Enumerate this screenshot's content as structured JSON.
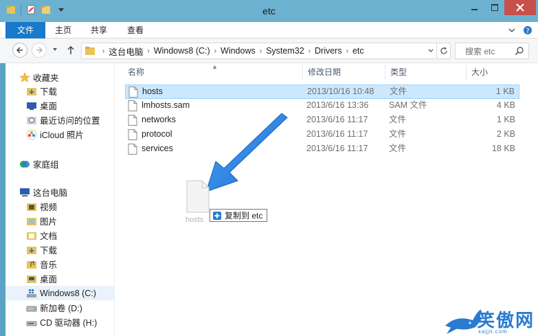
{
  "window": {
    "title": "etc"
  },
  "ribbon": {
    "tabs": [
      "文件",
      "主页",
      "共享",
      "查看"
    ]
  },
  "address": {
    "crumbs": [
      "这台电脑",
      "Windows8 (C:)",
      "Windows",
      "System32",
      "Drivers",
      "etc"
    ],
    "search_placeholder": "搜索 etc"
  },
  "sidebar": {
    "favorites_label": "收藏夹",
    "favorites": [
      "下载",
      "桌面",
      "最近访问的位置",
      "iCloud 照片"
    ],
    "homegroup_label": "家庭组",
    "pc_label": "这台电脑",
    "pc_items": [
      "视频",
      "图片",
      "文档",
      "下载",
      "音乐",
      "桌面",
      "Windows8 (C:)",
      "新加卷 (D:)",
      "CD 驱动器 (H:)"
    ],
    "selected": "Windows8 (C:)"
  },
  "columns": {
    "name": "名称",
    "date": "修改日期",
    "type": "类型",
    "size": "大小"
  },
  "files": [
    {
      "name": "hosts",
      "date": "2013/10/16 10:48",
      "type": "文件",
      "size": "1 KB",
      "selected": true
    },
    {
      "name": "lmhosts.sam",
      "date": "2013/6/16 13:36",
      "type": "SAM 文件",
      "size": "4 KB",
      "selected": false
    },
    {
      "name": "networks",
      "date": "2013/6/16 11:17",
      "type": "文件",
      "size": "1 KB",
      "selected": false
    },
    {
      "name": "protocol",
      "date": "2013/6/16 11:17",
      "type": "文件",
      "size": "2 KB",
      "selected": false
    },
    {
      "name": "services",
      "date": "2013/6/16 11:17",
      "type": "文件",
      "size": "18 KB",
      "selected": false
    }
  ],
  "drag": {
    "ghost_label": "hosts",
    "tooltip": "复制到 etc"
  },
  "watermark": {
    "text": "笑傲网",
    "url": "xajjn.com"
  },
  "colors": {
    "titlebar": "#6cb1cf",
    "file_tab": "#1979ca",
    "selection": "#cce8ff",
    "arrow": "#2f8ae6"
  }
}
